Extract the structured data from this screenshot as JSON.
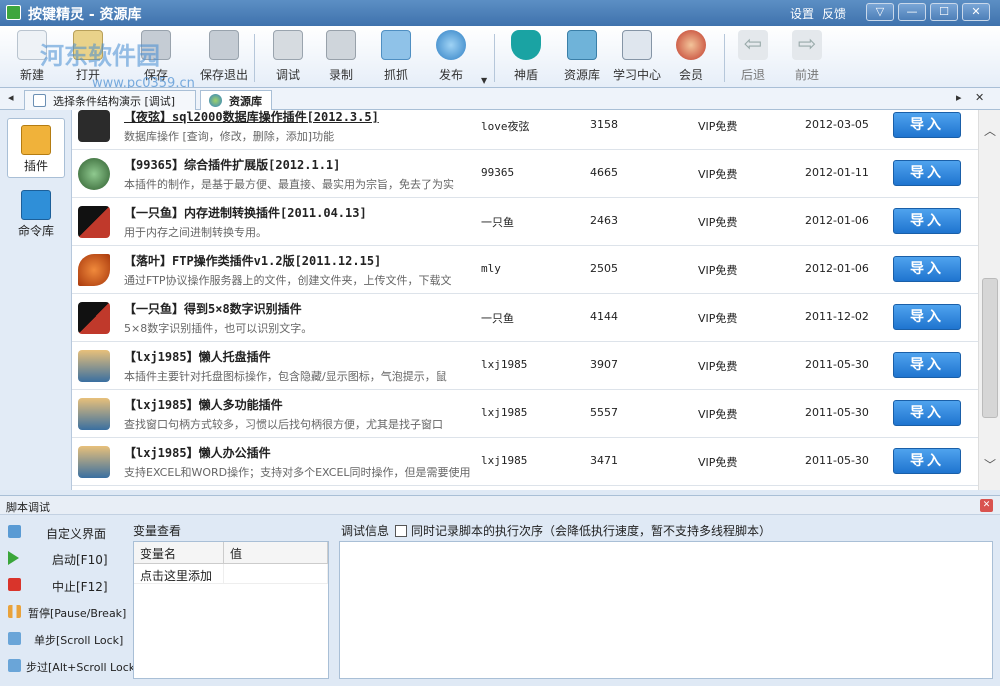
{
  "window": {
    "title": "按键精灵 - 资源库",
    "links": [
      "设置",
      "反馈"
    ],
    "controls": [
      "▽",
      "—",
      "☐",
      "✕"
    ]
  },
  "watermark": {
    "line1": "河东软件园",
    "line2": "www.pc0359.cn"
  },
  "toolbar": {
    "buttons": [
      {
        "label": "新建",
        "icon": "new-file-icon"
      },
      {
        "label": "打开",
        "icon": "open-folder-icon"
      },
      {
        "label": "保存",
        "icon": "save-disk-icon"
      },
      {
        "label": "保存退出",
        "icon": "save-exit-icon"
      },
      {
        "label": "调试",
        "icon": "debug-icon"
      },
      {
        "label": "录制",
        "icon": "record-camera-icon"
      },
      {
        "label": "抓抓",
        "icon": "grab-hand-icon"
      },
      {
        "label": "发布",
        "icon": "publish-globe-icon"
      },
      {
        "label": "神盾",
        "icon": "shield-icon"
      },
      {
        "label": "资源库",
        "icon": "resource-library-icon"
      },
      {
        "label": "学习中心",
        "icon": "learning-book-icon"
      },
      {
        "label": "会员",
        "icon": "member-user-icon"
      },
      {
        "label": "后退",
        "icon": "back-arrow-icon"
      },
      {
        "label": "前进",
        "icon": "forward-arrow-icon"
      }
    ],
    "colors": {
      "accent": "#3f72ad",
      "shield": "#1aa3a3"
    }
  },
  "tabs": {
    "items": [
      {
        "label": "选择条件结构演示 [调试]"
      },
      {
        "label": "资源库"
      }
    ],
    "left_arrow": "◂",
    "right_arrow": "▸",
    "close": "✕"
  },
  "sidebar": {
    "items": [
      {
        "label": "插件",
        "icon": "plugin-icon"
      },
      {
        "label": "命令库",
        "icon": "command-library-icon"
      }
    ]
  },
  "list": {
    "import_label": "导入",
    "rows": [
      {
        "title": "【夜弦】sql2000数据库操作插件[2012.3.5]",
        "desc": "数据库操作 [查询，修改，删除，添加]功能",
        "author": "love夜弦",
        "count": "3158",
        "price": "VIP免费",
        "date": "2012-03-05"
      },
      {
        "title": "【99365】综合插件扩展版[2012.1.1]",
        "desc": "本插件的制作，是基于最方便、最直接、最实用为宗旨，免去了为实",
        "author": "99365",
        "count": "4665",
        "price": "VIP免费",
        "date": "2012-01-11"
      },
      {
        "title": "【一只鱼】内存进制转换插件[2011.04.13]",
        "desc": "用于内存之间进制转换专用。",
        "author": "一只鱼",
        "count": "2463",
        "price": "VIP免费",
        "date": "2012-01-06"
      },
      {
        "title": "【落叶】FTP操作类插件v1.2版[2011.12.15]",
        "desc": "通过FTP协议操作服务器上的文件，创建文件夹，上传文件，下载文",
        "author": "mly",
        "count": "2505",
        "price": "VIP免费",
        "date": "2012-01-06"
      },
      {
        "title": "【一只鱼】得到5×8数字识别插件",
        "desc": "5×8数字识别插件，也可以识别文字。",
        "author": "一只鱼",
        "count": "4144",
        "price": "VIP免费",
        "date": "2011-12-02"
      },
      {
        "title": "【lxj1985】懒人托盘插件",
        "desc": "本插件主要针对托盘图标操作，包含隐藏/显示图标，气泡提示，鼠",
        "author": "lxj1985",
        "count": "3907",
        "price": "VIP免费",
        "date": "2011-05-30"
      },
      {
        "title": "【lxj1985】懒人多功能插件",
        "desc": "查找窗口句柄方式较多，习惯以后找句柄很方便，尤其是找子窗口",
        "author": "lxj1985",
        "count": "5557",
        "price": "VIP免费",
        "date": "2011-05-30"
      },
      {
        "title": "【lxj1985】懒人办公插件",
        "desc": "支持EXCEL和WORD操作；支持对多个EXCEL同时操作，但是需要使用",
        "author": "lxj1985",
        "count": "3471",
        "price": "VIP免费",
        "date": "2011-05-30"
      }
    ]
  },
  "debug": {
    "title": "脚本调试",
    "commands": [
      {
        "label": "自定义界面",
        "icon": "custom-ui-icon"
      },
      {
        "label": "启动[F10]",
        "icon": "start-play-icon"
      },
      {
        "label": "中止[F12]",
        "icon": "stop-icon"
      },
      {
        "label": "暂停[Pause/Break]",
        "icon": "pause-icon"
      },
      {
        "label": "单步[Scroll Lock]",
        "icon": "step-icon"
      },
      {
        "label": "步过[Alt+Scroll Lock]",
        "icon": "step-over-icon"
      }
    ],
    "var_view_label": "变量查看",
    "var_columns": [
      "变量名",
      "值"
    ],
    "var_rows": [
      [
        "点击这里添加",
        ""
      ]
    ],
    "info_label": "调试信息",
    "record_order_label": "同时记录脚本的执行次序（会降低执行速度，暂不支持多线程脚本）",
    "record_order_checked": false
  }
}
